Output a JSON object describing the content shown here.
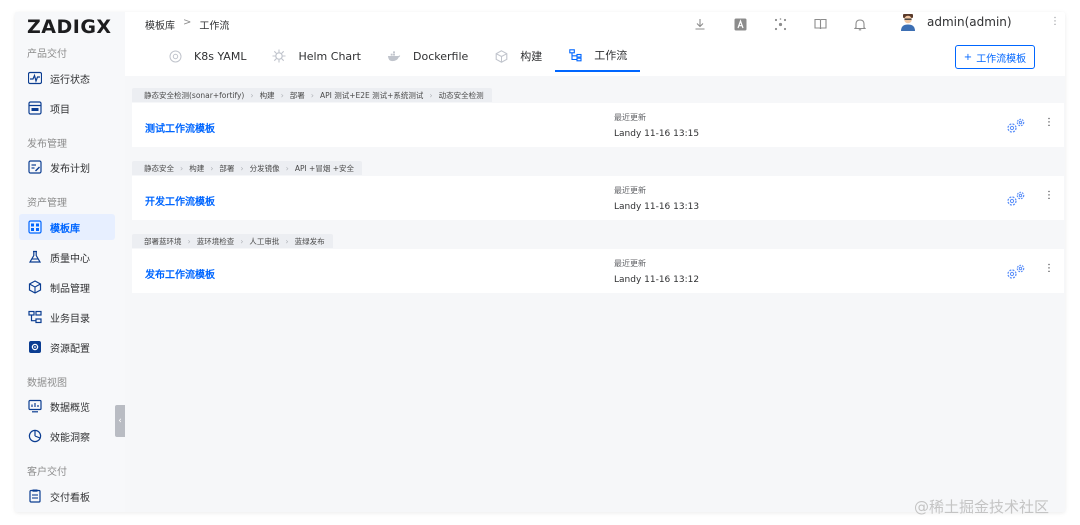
{
  "brand": {
    "logo": "ZADIGX"
  },
  "sidebar": {
    "sections": [
      {
        "title": "产品交付",
        "items": [
          {
            "label": "运行状态",
            "icon": "pulse-icon"
          },
          {
            "label": "项目",
            "icon": "project-icon"
          }
        ]
      },
      {
        "title": "发布管理",
        "items": [
          {
            "label": "发布计划",
            "icon": "plan-icon"
          }
        ]
      },
      {
        "title": "资产管理",
        "items": [
          {
            "label": "模板库",
            "icon": "template-icon",
            "active": true
          },
          {
            "label": "质量中心",
            "icon": "flask-icon"
          },
          {
            "label": "制品管理",
            "icon": "package-icon"
          },
          {
            "label": "业务目录",
            "icon": "catalog-icon"
          },
          {
            "label": "资源配置",
            "icon": "settings-icon"
          }
        ]
      },
      {
        "title": "数据视图",
        "items": [
          {
            "label": "数据概览",
            "icon": "chart-icon"
          },
          {
            "label": "效能洞察",
            "icon": "pie-icon"
          }
        ]
      },
      {
        "title": "客户交付",
        "items": [
          {
            "label": "交付看板",
            "icon": "board-icon"
          }
        ]
      }
    ]
  },
  "breadcrumb": {
    "root": "模板库",
    "separator": ">",
    "current": "工作流"
  },
  "user": {
    "name": "admin(admin)"
  },
  "tabs": [
    {
      "label": "K8s YAML",
      "icon": "k8s-icon"
    },
    {
      "label": "Helm Chart",
      "icon": "helm-icon"
    },
    {
      "label": "Dockerfile",
      "icon": "docker-icon"
    },
    {
      "label": "构建",
      "icon": "build-icon"
    },
    {
      "label": "工作流",
      "icon": "workflow-icon",
      "active": true
    }
  ],
  "new_button": {
    "label": "工作流模板",
    "icon": "plus-icon"
  },
  "templates": [
    {
      "stages": [
        "静态安全检测(sonar+fortify)",
        "构建",
        "部署",
        "API 测试+E2E 测试+系统测试",
        "动态安全检测"
      ],
      "name": "测试工作流模板",
      "updated_label": "最近更新",
      "updated_value": "Landy 11-16 13:15"
    },
    {
      "stages": [
        "静态安全",
        "构建",
        "部署",
        "分发镜像",
        "API +冒烟 +安全"
      ],
      "name": "开发工作流模板",
      "updated_label": "最近更新",
      "updated_value": "Landy 11-16 13:13"
    },
    {
      "stages": [
        "部署蓝环境",
        "蓝环境检查",
        "人工审批",
        "蓝绿发布"
      ],
      "name": "发布工作流模板",
      "updated_label": "最近更新",
      "updated_value": "Landy 11-16 13:12"
    }
  ],
  "watermark": "@稀土掘金技术社区",
  "colors": {
    "accent": "#0066ff",
    "active_bg": "#e7efff",
    "stage_bg": "#eceef2"
  }
}
